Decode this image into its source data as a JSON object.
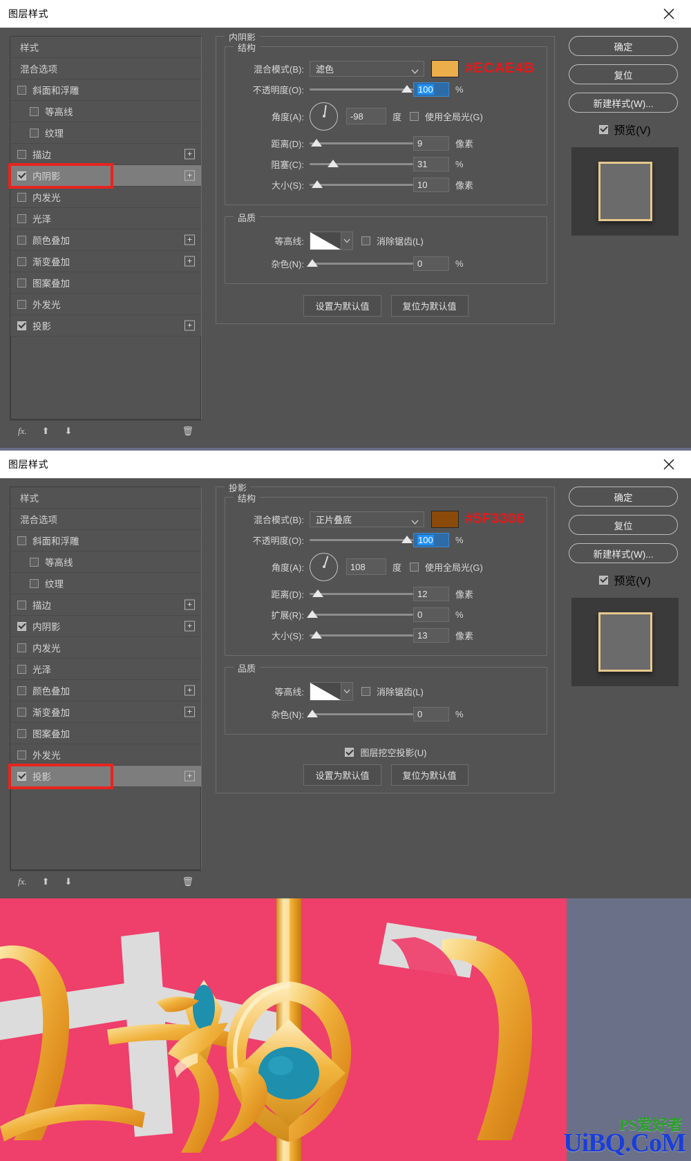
{
  "app": {
    "title": "图层样式"
  },
  "style_list": {
    "header_items": [
      {
        "label": "样式"
      },
      {
        "label": "混合选项"
      }
    ],
    "items": [
      {
        "label": "斜面和浮雕",
        "checked": false,
        "indent": false,
        "plus": false
      },
      {
        "label": "等高线",
        "checked": false,
        "indent": true,
        "plus": false
      },
      {
        "label": "纹理",
        "checked": false,
        "indent": true,
        "plus": false
      },
      {
        "label": "描边",
        "checked": false,
        "indent": false,
        "plus": true
      },
      {
        "label": "内阴影",
        "checked": true,
        "indent": false,
        "plus": true
      },
      {
        "label": "内发光",
        "checked": false,
        "indent": false,
        "plus": false
      },
      {
        "label": "光泽",
        "checked": false,
        "indent": false,
        "plus": false
      },
      {
        "label": "颜色叠加",
        "checked": false,
        "indent": false,
        "plus": true
      },
      {
        "label": "渐变叠加",
        "checked": false,
        "indent": false,
        "plus": true
      },
      {
        "label": "图案叠加",
        "checked": false,
        "indent": false,
        "plus": false
      },
      {
        "label": "外发光",
        "checked": false,
        "indent": false,
        "plus": false
      },
      {
        "label": "投影",
        "checked": true,
        "indent": false,
        "plus": true
      }
    ],
    "footer_icons": {
      "fx": "fx-icon",
      "up": "arrow-up-icon",
      "down": "arrow-down-icon",
      "trash": "trash-icon"
    }
  },
  "dialog1": {
    "panel_title": "内阴影",
    "structure_legend": "结构",
    "quality_legend": "品质",
    "blend_mode_label": "混合模式(B):",
    "blend_mode_value": "滤色",
    "color_hex": "#ECAE4B",
    "color_swatch": "#ecae4b",
    "opacity_label": "不透明度(O):",
    "opacity_value": "100",
    "opacity_unit": "%",
    "angle_label": "角度(A):",
    "angle_value": "-98",
    "angle_unit": "度",
    "global_light_label": "使用全局光(G)",
    "global_light_checked": false,
    "distance_label": "距离(D):",
    "distance_value": "9",
    "distance_unit": "像素",
    "choke_label": "阻塞(C):",
    "choke_value": "31",
    "choke_unit": "%",
    "size_label": "大小(S):",
    "size_value": "10",
    "size_unit": "像素",
    "contour_label": "等高线:",
    "antialias_label": "消除锯齿(L)",
    "antialias_checked": false,
    "noise_label": "杂色(N):",
    "noise_value": "0",
    "noise_unit": "%",
    "set_default_btn": "设置为默认值",
    "reset_default_btn": "复位为默认值",
    "highlighted_row": "内阴影"
  },
  "dialog2": {
    "panel_title": "投影",
    "structure_legend": "结构",
    "quality_legend": "品质",
    "blend_mode_label": "混合模式(B):",
    "blend_mode_value": "正片叠底",
    "color_hex": "#5F3306",
    "color_swatch": "#8a4a09",
    "opacity_label": "不透明度(O):",
    "opacity_value": "100",
    "opacity_unit": "%",
    "angle_label": "角度(A):",
    "angle_value": "108",
    "angle_unit": "度",
    "global_light_label": "使用全局光(G)",
    "global_light_checked": false,
    "distance_label": "距离(D):",
    "distance_value": "12",
    "distance_unit": "像素",
    "spread_label": "扩展(R):",
    "spread_value": "0",
    "spread_unit": "%",
    "size_label": "大小(S):",
    "size_value": "13",
    "size_unit": "像素",
    "contour_label": "等高线:",
    "antialias_label": "消除锯齿(L)",
    "antialias_checked": false,
    "noise_label": "杂色(N):",
    "noise_value": "0",
    "noise_unit": "%",
    "knockout_label": "图层挖空投影(U)",
    "knockout_checked": true,
    "set_default_btn": "设置为默认值",
    "reset_default_btn": "复位为默认值",
    "highlighted_row": "投影"
  },
  "buttons": {
    "ok": "确定",
    "reset": "复位",
    "new_style": "新建样式(W)...",
    "preview": "预览(V)",
    "preview_checked": true
  },
  "artwork": {
    "watermark_main": "UiBQ.CoM",
    "watermark_sub": "PS爱好者",
    "bg_color": "#6b7089",
    "pink": "#ef3f6b",
    "gold": "#f0b23c",
    "teal": "#1e8fad",
    "white": "#d8d8d8"
  }
}
